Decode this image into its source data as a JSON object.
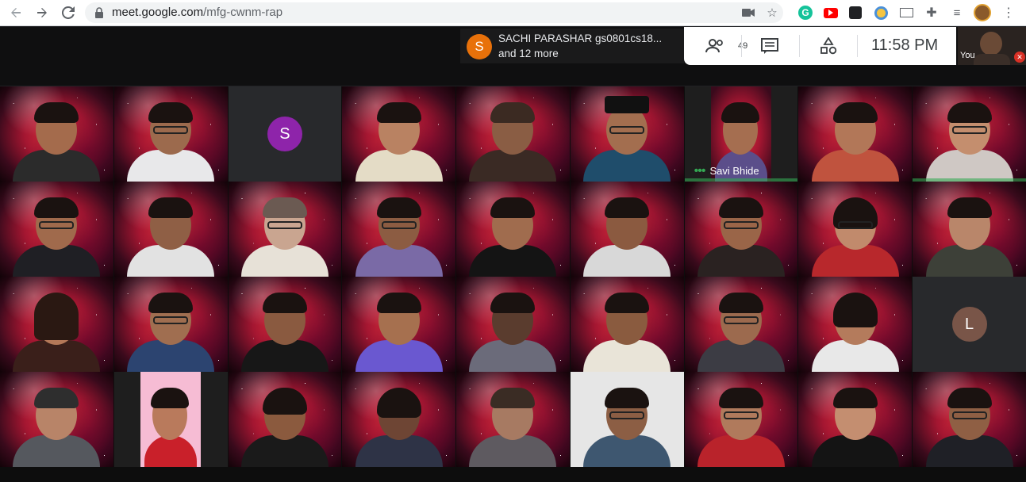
{
  "browser": {
    "url_host": "meet.google.com",
    "url_path": "/mfg-cwnm-rap",
    "icons": [
      "back-icon",
      "forward-icon",
      "reload-icon",
      "lock-icon",
      "camera-blocked-icon",
      "star-icon",
      "grammarly-icon",
      "youtube-icon",
      "extension-icon",
      "timer-icon",
      "mail-icon",
      "puzzle-icon",
      "media-icon",
      "profile-icon",
      "menu-icon"
    ]
  },
  "notification": {
    "avatar_letter": "S",
    "line1": "SACHI PARASHAR gs0801cs18...",
    "line2": "and 12 more"
  },
  "meet_controls": {
    "participant_count": "49",
    "time": "11:58  PM",
    "self_label": "You"
  },
  "tiles": {
    "letter_s": "S",
    "letter_l": "L",
    "savi_name": "Savi Bhide"
  },
  "colors": {
    "accent_green": "#34a853",
    "avatar_s": "#8e24aa",
    "avatar_l": "#795548",
    "toast_avatar": "#e8710a"
  }
}
